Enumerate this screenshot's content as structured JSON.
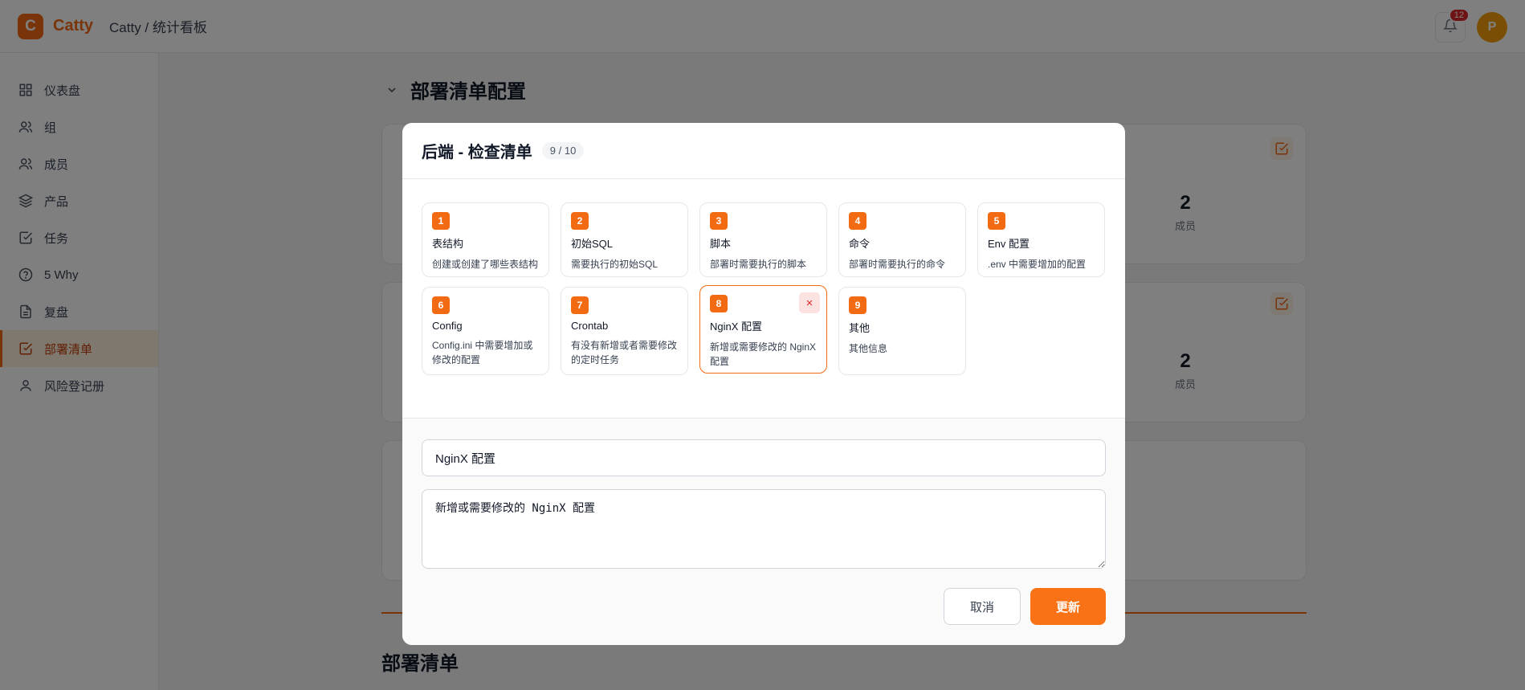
{
  "app": {
    "logo_letter": "C",
    "name": "Catty",
    "breadcrumb": "Catty / 统计看板"
  },
  "header": {
    "notification_count": "12",
    "avatar_initial": "P"
  },
  "sidebar": {
    "items": [
      {
        "label": "仪表盘",
        "icon": "dashboard-icon"
      },
      {
        "label": "组",
        "icon": "users-icon"
      },
      {
        "label": "成员",
        "icon": "users-icon"
      },
      {
        "label": "产品",
        "icon": "layers-icon"
      },
      {
        "label": "任务",
        "icon": "check-square-icon"
      },
      {
        "label": "5 Why",
        "icon": "help-circle-icon"
      },
      {
        "label": "复盘",
        "icon": "document-icon"
      },
      {
        "label": "部署清单",
        "icon": "check-square-icon",
        "active": true
      },
      {
        "label": "风险登记册",
        "icon": "user-icon"
      }
    ]
  },
  "main": {
    "section_title": "部署清单配置",
    "cards": [
      {
        "stat_value": "2",
        "stat_label": "成员"
      },
      {
        "stat_value": "2",
        "stat_label": "成员"
      }
    ],
    "section2_title": "部署清单"
  },
  "modal": {
    "title": "后端 - 检查清单",
    "count": "9 / 10",
    "items": [
      {
        "num": "1",
        "title": "表结构",
        "desc": "创建或创建了哪些表结构"
      },
      {
        "num": "2",
        "title": "初始SQL",
        "desc": "需要执行的初始SQL"
      },
      {
        "num": "3",
        "title": "脚本",
        "desc": "部署时需要执行的脚本"
      },
      {
        "num": "4",
        "title": "命令",
        "desc": "部署时需要执行的命令"
      },
      {
        "num": "5",
        "title": "Env 配置",
        "desc": ".env 中需要增加的配置"
      },
      {
        "num": "6",
        "title": "Config",
        "desc": "Config.ini 中需要增加或修改的配置"
      },
      {
        "num": "7",
        "title": "Crontab",
        "desc": "有没有新增或者需要修改的定时任务"
      },
      {
        "num": "8",
        "title": "NginX 配置",
        "desc": "新增或需要修改的 NginX 配置",
        "selected": true
      },
      {
        "num": "9",
        "title": "其他",
        "desc": "其他信息"
      }
    ],
    "remove_symbol": "×",
    "form": {
      "title_value": "NginX 配置",
      "desc_value": "新增或需要修改的 NginX 配置"
    },
    "cancel_label": "取消",
    "update_label": "更新"
  },
  "colors": {
    "accent": "#f26a12",
    "danger": "#dc2626"
  }
}
